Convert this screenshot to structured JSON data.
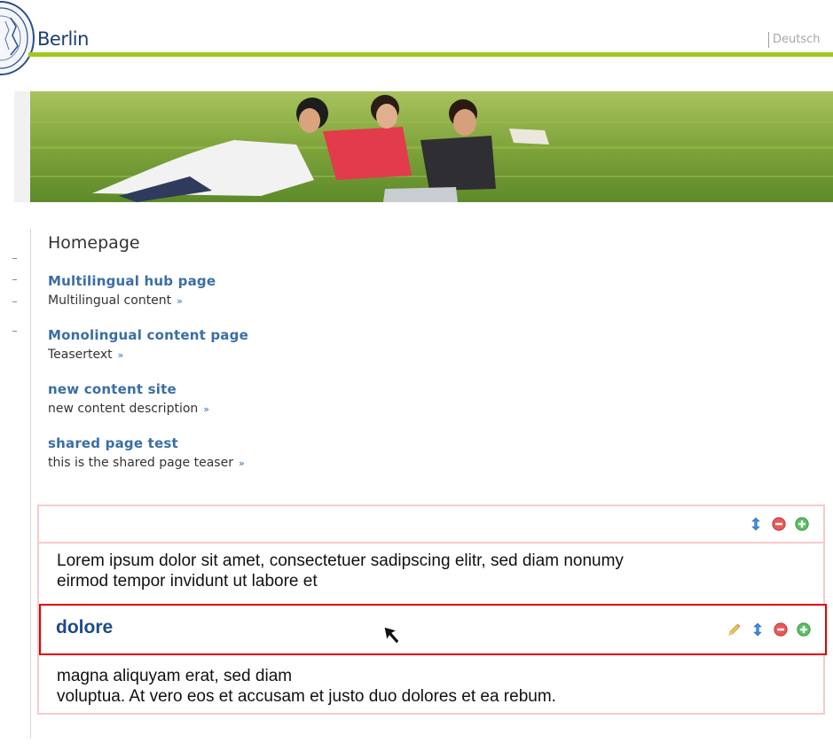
{
  "header": {
    "brand": "Berlin",
    "language_link": "Deutsch",
    "accent_color": "#9fca1a"
  },
  "banner": {
    "description_icon": "banner-photo"
  },
  "main": {
    "title": "Homepage",
    "teasers": [
      {
        "title": "Multilingual hub page",
        "text": "Multilingual content",
        "more": "»"
      },
      {
        "title": "Monolingual content page",
        "text": "Teasertext",
        "more": "»"
      },
      {
        "title": "new content site",
        "text": "new content description",
        "more": "»"
      },
      {
        "title": "shared page test",
        "text": "this is the shared page teaser",
        "more": "»"
      }
    ]
  },
  "editor": {
    "paragraph1_line1": "Lorem ipsum dolor sit amet, consectetuer sadipscing elitr, sed diam nonumy",
    "paragraph1_line2": "eirmod tempor invidunt ut labore et",
    "heading": "dolore",
    "paragraph2_line1": "magna aliquyam erat, sed diam",
    "paragraph2_line2": "voluptua. At vero eos et accusam et justo duo dolores et ea rebum.",
    "icons": [
      "pencil-icon",
      "move-icon",
      "remove-icon",
      "add-icon"
    ],
    "highlight_color": "#e00000"
  }
}
